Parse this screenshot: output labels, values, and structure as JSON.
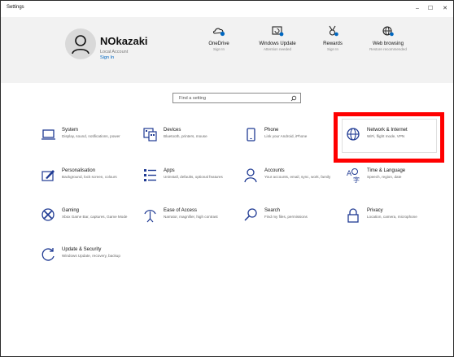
{
  "window": {
    "title": "Settings",
    "minimize": "–",
    "maximize": "☐",
    "close": "✕"
  },
  "account": {
    "name": "NOkazaki",
    "type": "Local Account",
    "sign_in": "Sign In"
  },
  "header_items": [
    {
      "label": "OneDrive",
      "sub": "Sign In",
      "icon": "onedrive-icon"
    },
    {
      "label": "Windows Update",
      "sub": "Attention needed",
      "icon": "windows-update-icon"
    },
    {
      "label": "Rewards",
      "sub": "Sign In",
      "icon": "rewards-icon"
    },
    {
      "label": "Web browsing",
      "sub": "Restore recommended",
      "icon": "globe-icon"
    }
  ],
  "search": {
    "placeholder": "Find a setting"
  },
  "categories": [
    {
      "title": "System",
      "desc": "Display, sound, notifications, power",
      "icon": "laptop-icon"
    },
    {
      "title": "Devices",
      "desc": "Bluetooth, printers, mouse",
      "icon": "keyboard-icon"
    },
    {
      "title": "Phone",
      "desc": "Link your Android, iPhone",
      "icon": "phone-icon"
    },
    {
      "title": "Network & Internet",
      "desc": "WiFi, flight mode, VPN",
      "icon": "globe-icon"
    },
    {
      "title": "Personalisation",
      "desc": "Background, lock screen, colours",
      "icon": "paint-icon"
    },
    {
      "title": "Apps",
      "desc": "Uninstall, defaults, optional features",
      "icon": "apps-list-icon"
    },
    {
      "title": "Accounts",
      "desc": "Your accounts, email, sync, work, family",
      "icon": "person-icon"
    },
    {
      "title": "Time & Language",
      "desc": "Speech, region, date",
      "icon": "time-language-icon"
    },
    {
      "title": "Gaming",
      "desc": "Xbox Game Bar, captures, Game Mode",
      "icon": "xbox-icon"
    },
    {
      "title": "Ease of Access",
      "desc": "Narrator, magnifier, high contrast",
      "icon": "ease-of-access-icon"
    },
    {
      "title": "Search",
      "desc": "Find my files, permissions",
      "icon": "search-icon"
    },
    {
      "title": "Privacy",
      "desc": "Location, camera, microphone",
      "icon": "lock-icon"
    },
    {
      "title": "Update & Security",
      "desc": "Windows Update, recovery, backup",
      "icon": "refresh-icon"
    }
  ],
  "colors": {
    "accent": "#0067c0",
    "highlight": "#ff0000",
    "header_bg": "#f2f2f2"
  }
}
